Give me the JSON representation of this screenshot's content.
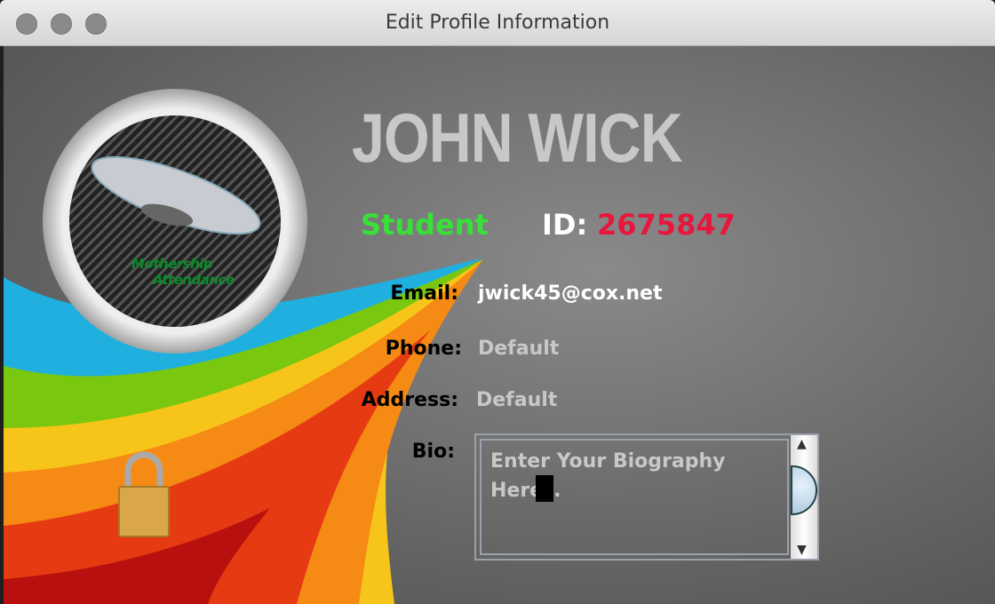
{
  "window": {
    "title": "Edit Profile Information"
  },
  "logo": {
    "line1": "Mothership",
    "line2": "Attendance"
  },
  "profile": {
    "name": "JOHN WICK",
    "role": "Student",
    "id_label": "ID:",
    "id_value": "2675847"
  },
  "fields": {
    "email": {
      "label": "Email:",
      "value": "jwick45@cox.net"
    },
    "phone": {
      "label": "Phone:",
      "value": "Default"
    },
    "address": {
      "label": "Address:",
      "value": "Default"
    },
    "bio": {
      "label": "Bio:",
      "value": "Enter Your Biography Here"
    }
  },
  "colors": {
    "role": "#38e038",
    "id": "#e8163c",
    "name": "#c8c8c8",
    "placeholder": "#c8c8c8"
  },
  "icons": {
    "lock": "padlock-icon"
  }
}
